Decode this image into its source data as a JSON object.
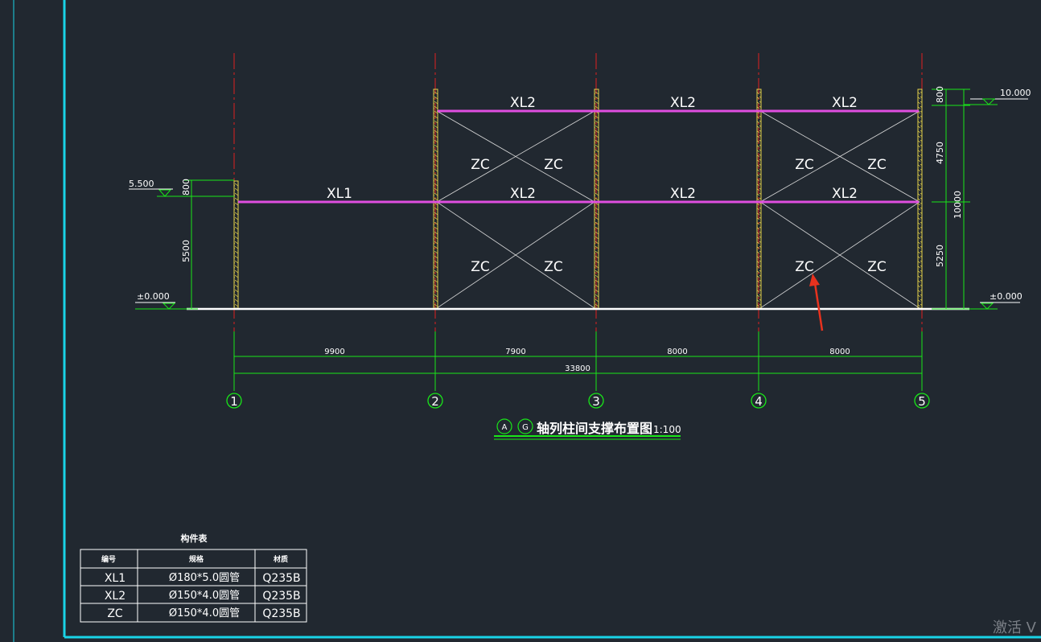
{
  "elements": {
    "member_labels": {
      "xl1": "XL1",
      "xl2_top": [
        "XL2",
        "XL2",
        "XL2"
      ],
      "xl2_mid": [
        "XL2",
        "XL2",
        "XL2"
      ],
      "zc": "ZC"
    },
    "elevations": {
      "left_top": "5.500",
      "left_bottom": "±0.000",
      "right_top": "10.000",
      "right_bottom": "±0.000"
    },
    "vertical_dims": {
      "left_upper": "800",
      "left_lower": "5500",
      "right_top": "800",
      "right_mid": "4750",
      "right_lower": "5250",
      "right_total": "10000"
    },
    "horizontal_dims": [
      "9900",
      "7900",
      "8000",
      "8000"
    ],
    "total_dim": "33800",
    "axis_labels": [
      "1",
      "2",
      "3",
      "4",
      "5"
    ],
    "title": {
      "circle_a": "A",
      "circle_g": "G",
      "text": "轴列柱间支撑布置图",
      "scale": "1:100"
    }
  },
  "table": {
    "title": "构件表",
    "headers": [
      "编号",
      "规格",
      "材质"
    ],
    "rows": [
      [
        "XL1",
        "Ø180*5.0圆管",
        "Q235B"
      ],
      [
        "XL2",
        "Ø150*4.0圆管",
        "Q235B"
      ],
      [
        "ZC",
        "Ø150*4.0圆管",
        "Q235B"
      ]
    ]
  },
  "watermark": "激活 V",
  "colors": {
    "background": "#212830",
    "frame": "#19d3e6",
    "beam": "#e04ee0",
    "column": "#e8d44a",
    "dimension": "#19e619",
    "axis_line": "#e02020",
    "brace": "#d9d9d9",
    "arrow": "#e8321e"
  }
}
